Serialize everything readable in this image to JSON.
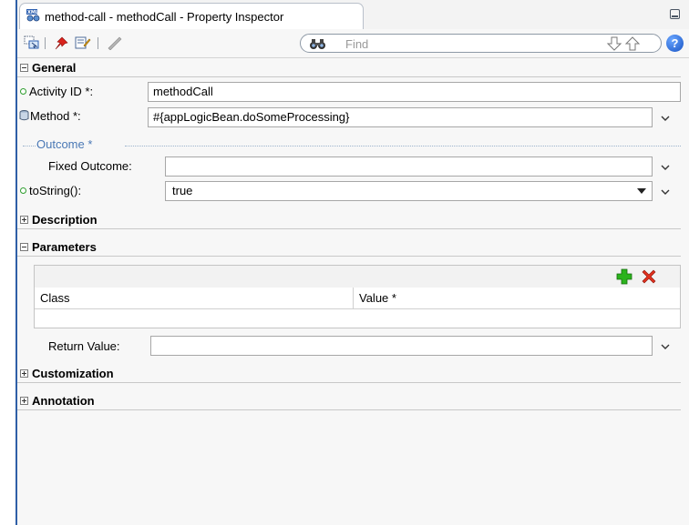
{
  "window": {
    "title": "method-call - methodCall - Property Inspector"
  },
  "toolbar": {
    "find_placeholder": "Find",
    "help_label": "?"
  },
  "sections": {
    "general": {
      "title": "General",
      "activity_id": {
        "label": "Activity ID *:",
        "value": "methodCall"
      },
      "method": {
        "label": "Method *:",
        "value": "#{appLogicBean.doSomeProcessing}"
      },
      "outcome_group": "Outcome *",
      "fixed_outcome": {
        "label": "Fixed Outcome:",
        "value": ""
      },
      "to_string": {
        "label": "toString():",
        "value": "true"
      }
    },
    "description": {
      "title": "Description"
    },
    "parameters": {
      "title": "Parameters",
      "columns": [
        "Class",
        "Value *"
      ],
      "return_value": {
        "label": "Return Value:",
        "value": ""
      }
    },
    "customization": {
      "title": "Customization"
    },
    "annotation": {
      "title": "Annotation"
    }
  },
  "icons": {
    "accent": "#2f5fa7",
    "required_bullet_color": "#2f9e2f",
    "add_color": "#2bb31d",
    "delete_color": "#e0301e"
  }
}
